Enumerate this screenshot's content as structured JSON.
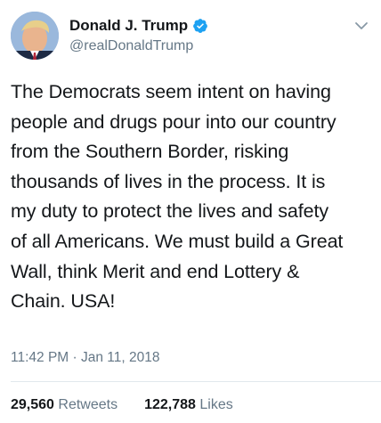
{
  "author": {
    "display_name": "Donald J. Trump",
    "handle": "@realDonaldTrump",
    "verified": true,
    "verified_color": "#1da1f2"
  },
  "tweet": {
    "lines": [
      "The Democrats seem intent on having",
      "people and drugs pour into our country",
      "from the Southern Border, risking",
      "thousands of lives in the process. It is",
      "my duty to protect the lives and safety",
      "of all Americans. We must build a Great",
      "Wall, think Merit and end Lottery &",
      "Chain. USA!"
    ],
    "timestamp": "11:42 PM · Jan 11, 2018"
  },
  "stats": {
    "retweets_count": "29,560",
    "retweets_label": "Retweets",
    "likes_count": "122,788",
    "likes_label": "Likes"
  },
  "icons": {
    "menu": "chevron-down-icon",
    "verified": "verified-badge-icon"
  }
}
